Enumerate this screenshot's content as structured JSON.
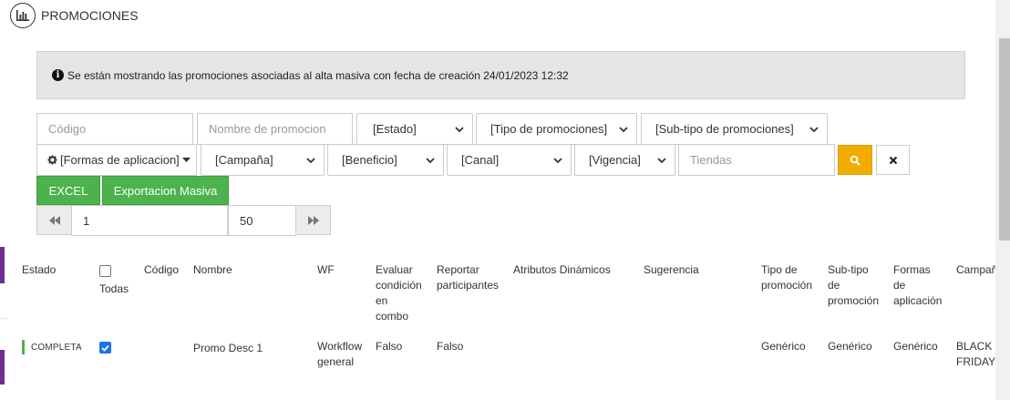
{
  "header": {
    "title": "PROMOCIONES",
    "icon": "bar-chart-icon"
  },
  "info": {
    "icon": "info-circle-icon",
    "message": "Se están mostrando las promociones asociadas al alta masiva con fecha de creación 24/01/2023 12:32"
  },
  "filters": {
    "codigo_placeholder": "Código",
    "nombre_placeholder": "Nombre de promocion",
    "estado": "[Estado]",
    "tipo": "[Tipo de promociones]",
    "subtipo": "[Sub-tipo de promociones]",
    "formas": "[Formas de aplicacion]",
    "campana": "[Campaña]",
    "beneficio": "[Beneficio]",
    "canal": "[Canal]",
    "vigencia": "[Vigencia]",
    "tiendas_placeholder": "Tiendas"
  },
  "actions": {
    "excel": "EXCEL",
    "export": "Exportacion Masiva"
  },
  "pager": {
    "page": "1",
    "size": "50"
  },
  "table": {
    "headers": {
      "estado": "Estado",
      "todas": "Todas",
      "codigo": "Código",
      "nombre": "Nombre",
      "wf": "WF",
      "evaluar": [
        "Evaluar",
        "condición",
        "en",
        "combo"
      ],
      "reportar": [
        "Reportar",
        "participantes"
      ],
      "atributos": "Atributos Dinámicos",
      "sugerencia": "Sugerencia",
      "tipo": [
        "Tipo de",
        "promoción"
      ],
      "subtipo": [
        "Sub-tipo",
        "de",
        "promoción"
      ],
      "formas": [
        "Formas",
        "de",
        "aplicación"
      ],
      "campana": "Campañ"
    },
    "rows": [
      {
        "estado": "COMPLETA",
        "checked": true,
        "codigo": "",
        "nombre": "Promo Desc 1",
        "wf": [
          "Workflow",
          "general"
        ],
        "evaluar": "Falso",
        "reportar": "Falso",
        "atributos": "",
        "sugerencia": "",
        "tipo": "Genérico",
        "subtipo": "Genérico",
        "formas": "Genérico",
        "campana": [
          "BLACK",
          "FRIDAY"
        ]
      }
    ]
  },
  "colors": {
    "accent": "#6f2c91",
    "success": "#4cb34c",
    "warning": "#f0ad00",
    "checkbox": "#1a73e8"
  }
}
